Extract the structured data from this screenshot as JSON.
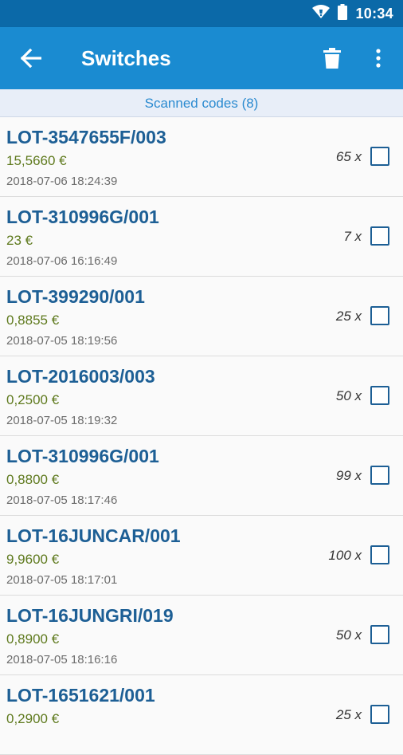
{
  "status": {
    "time": "10:34"
  },
  "appbar": {
    "title": "Switches"
  },
  "subheader": {
    "text": "Scanned codes (8)"
  },
  "items": [
    {
      "code": "LOT-3547655F/003",
      "price": "15,5660 €",
      "date": "2018-07-06 18:24:39",
      "qty": "65 x"
    },
    {
      "code": "LOT-310996G/001",
      "price": "23 €",
      "date": "2018-07-06 16:16:49",
      "qty": "7 x"
    },
    {
      "code": "LOT-399290/001",
      "price": "0,8855 €",
      "date": "2018-07-05 18:19:56",
      "qty": "25 x"
    },
    {
      "code": "LOT-2016003/003",
      "price": "0,2500 €",
      "date": "2018-07-05 18:19:32",
      "qty": "50 x"
    },
    {
      "code": "LOT-310996G/001",
      "price": "0,8800 €",
      "date": "2018-07-05 18:17:46",
      "qty": "99 x"
    },
    {
      "code": "LOT-16JUNCAR/001",
      "price": "9,9600 €",
      "date": "2018-07-05 18:17:01",
      "qty": "100 x"
    },
    {
      "code": "LOT-16JUNGRI/019",
      "price": "0,8900 €",
      "date": "2018-07-05 18:16:16",
      "qty": "50 x"
    },
    {
      "code": "LOT-1651621/001",
      "price": "0,2900 €",
      "date": "",
      "qty": "25 x"
    }
  ]
}
